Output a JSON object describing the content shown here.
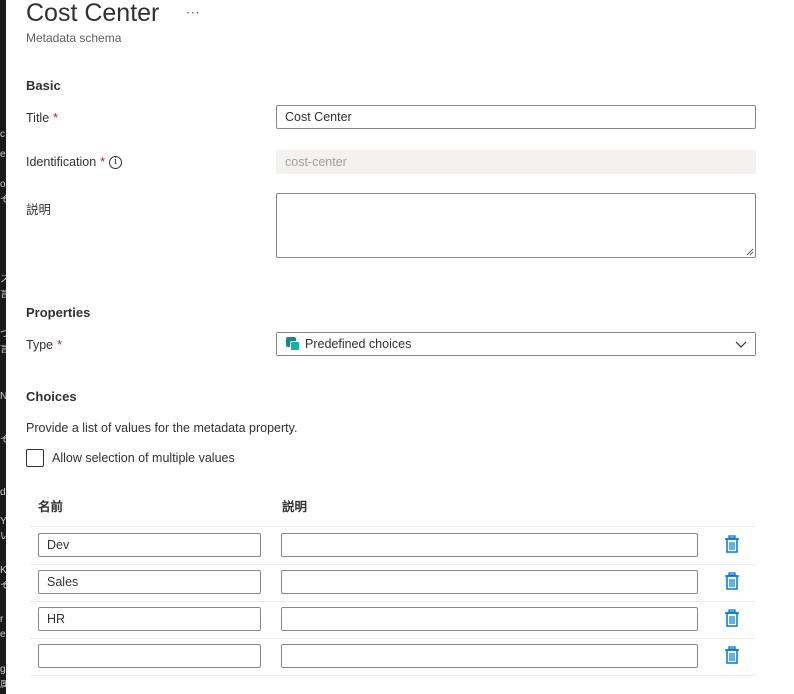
{
  "header": {
    "title": "Cost Center",
    "more_label": "···",
    "subtitle": "Metadata schema"
  },
  "sidebar_edge": {
    "glyphs": [
      "c",
      "e",
      "",
      "o",
      "そ",
      "",
      "",
      "",
      "",
      "",
      "ス",
      "言",
      "",
      "つ",
      "言",
      "",
      "N",
      "",
      "そ",
      "",
      "",
      "d",
      "",
      "Y",
      "い",
      "",
      "K",
      "そ",
      "r",
      "e",
      "g",
      "属"
    ]
  },
  "basic": {
    "section_label": "Basic",
    "title_field": {
      "label": "Title",
      "required_mark": "*",
      "value": "Cost Center"
    },
    "identification_field": {
      "label": "Identification",
      "required_mark": "*",
      "info_icon": "i",
      "value": "cost-center"
    },
    "description_field": {
      "label": "説明",
      "value": ""
    }
  },
  "properties": {
    "section_label": "Properties",
    "type_field": {
      "label": "Type",
      "required_mark": "*",
      "selected": "Predefined choices",
      "icon": "predefined-choices-icon"
    }
  },
  "choices": {
    "section_label": "Choices",
    "description": "Provide a list of values for the metadata property.",
    "allow_multiple": {
      "label": "Allow selection of multiple values",
      "checked": false
    },
    "columns": {
      "name": "名前",
      "description": "説明"
    },
    "rows": [
      {
        "name": "Dev",
        "description": ""
      },
      {
        "name": "Sales",
        "description": ""
      },
      {
        "name": "HR",
        "description": ""
      },
      {
        "name": "",
        "description": ""
      }
    ]
  },
  "colors": {
    "accent": "#0078d4",
    "required": "#a4262c",
    "type_icon": "#0f8b8d"
  }
}
